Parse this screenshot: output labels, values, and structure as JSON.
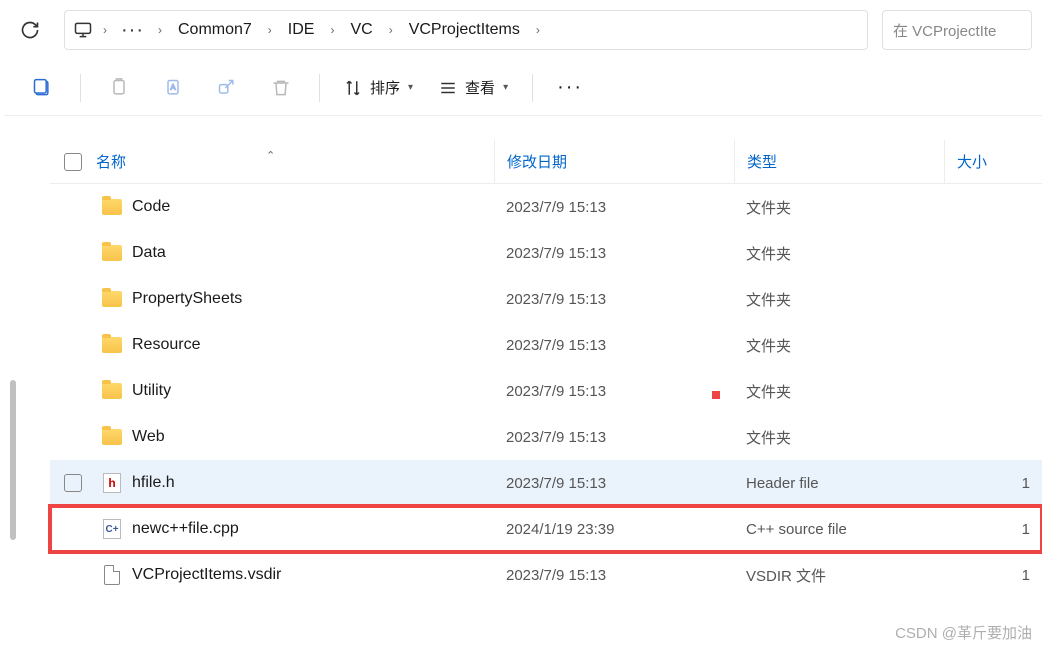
{
  "breadcrumb": {
    "overflow": "···",
    "segments": [
      "Common7",
      "IDE",
      "VC",
      "VCProjectItems"
    ]
  },
  "search": {
    "placeholder": "在 VCProjectIte"
  },
  "toolbar": {
    "sort_label": "排序",
    "view_label": "查看",
    "more": "···"
  },
  "headers": {
    "name": "名称",
    "date": "修改日期",
    "type": "类型",
    "size": "大小"
  },
  "rows": [
    {
      "icon": "folder",
      "name": "Code",
      "date": "2023/7/9 15:13",
      "type": "文件夹",
      "size": ""
    },
    {
      "icon": "folder",
      "name": "Data",
      "date": "2023/7/9 15:13",
      "type": "文件夹",
      "size": ""
    },
    {
      "icon": "folder",
      "name": "PropertySheets",
      "date": "2023/7/9 15:13",
      "type": "文件夹",
      "size": ""
    },
    {
      "icon": "folder",
      "name": "Resource",
      "date": "2023/7/9 15:13",
      "type": "文件夹",
      "size": ""
    },
    {
      "icon": "folder",
      "name": "Utility",
      "date": "2023/7/9 15:13",
      "type": "文件夹",
      "size": ""
    },
    {
      "icon": "folder",
      "name": "Web",
      "date": "2023/7/9 15:13",
      "type": "文件夹",
      "size": ""
    },
    {
      "icon": "h",
      "name": "hfile.h",
      "date": "2023/7/9 15:13",
      "type": "Header file",
      "size": "1",
      "hover": true
    },
    {
      "icon": "cpp",
      "name": "newc++file.cpp",
      "date": "2024/1/19 23:39",
      "type": "C++ source file",
      "size": "1",
      "highlight": true
    },
    {
      "icon": "file",
      "name": "VCProjectItems.vsdir",
      "date": "2023/7/9 15:13",
      "type": "VSDIR 文件",
      "size": "1"
    }
  ],
  "watermark": "CSDN @革斤要加油"
}
